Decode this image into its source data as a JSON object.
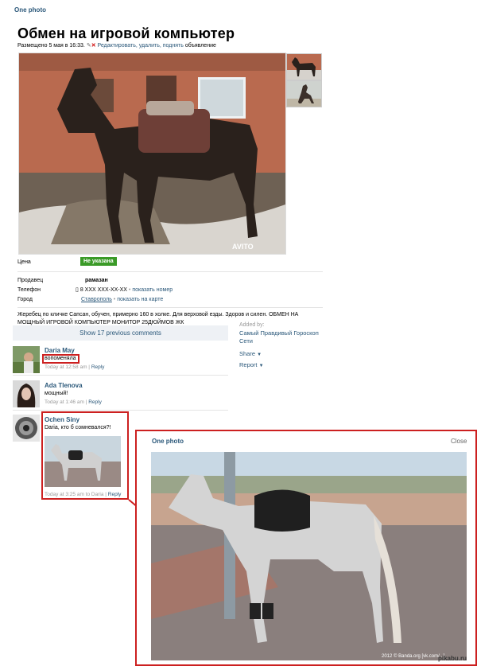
{
  "top_link": "One photo",
  "ad": {
    "title": "Обмен на игровой компьютер",
    "meta_prefix": "Размещено 5 мая в 16:33.",
    "edit_link": "Редактировать, удалить, поднять",
    "meta_suffix": "объявление",
    "watermark": "AVITO",
    "price_label": "Цена",
    "price_value": "Не указана",
    "seller_label": "Продавец",
    "seller_value": "рамазан",
    "phone_label": "Телефон",
    "phone_value": "8 XXX XXX-XX-XX",
    "phone_link": "показать номер",
    "city_label": "Город",
    "city_value": "Ставрополь",
    "city_link": "показать на карте",
    "description": "Жеребец по кличке Сапсан, обучен, примерно 160 в холке. Для верховой езды. Здоров и силен. ОБМЕН НА МОЩНЫЙ ИГРОВОЙ КОМПЬЮТЕР МОНИТОР 25ДЮЙМОВ ЖК"
  },
  "comments_bar": {
    "show_previous": "Show 17 previous comments"
  },
  "side": {
    "added_by": "Added by:",
    "group": "Самый Правдивый Гороскоп Сети",
    "share": "Share",
    "report": "Report"
  },
  "comments": [
    {
      "author": "Daria May",
      "text": "вопоменяла",
      "time": "Today at 12:58 am",
      "reply": "Reply"
    },
    {
      "author": "Ada Tlenova",
      "text": "мощный!",
      "time": "Today at 1:46 am",
      "reply": "Reply"
    },
    {
      "author": "Ochen Siny",
      "text": "Daria, кто б сомневался?!",
      "time": "Today at 3:25 am to Daria",
      "reply": "Reply"
    }
  ],
  "popup": {
    "title": "One photo",
    "close": "Close",
    "watermark": "2012 © Banda.org [vk.com/...]"
  },
  "site_watermark": "pikabu.ru",
  "colors": {
    "price_badge": "#3a9a27",
    "highlight_red": "#cc2020",
    "link_blue": "#2b587a"
  }
}
